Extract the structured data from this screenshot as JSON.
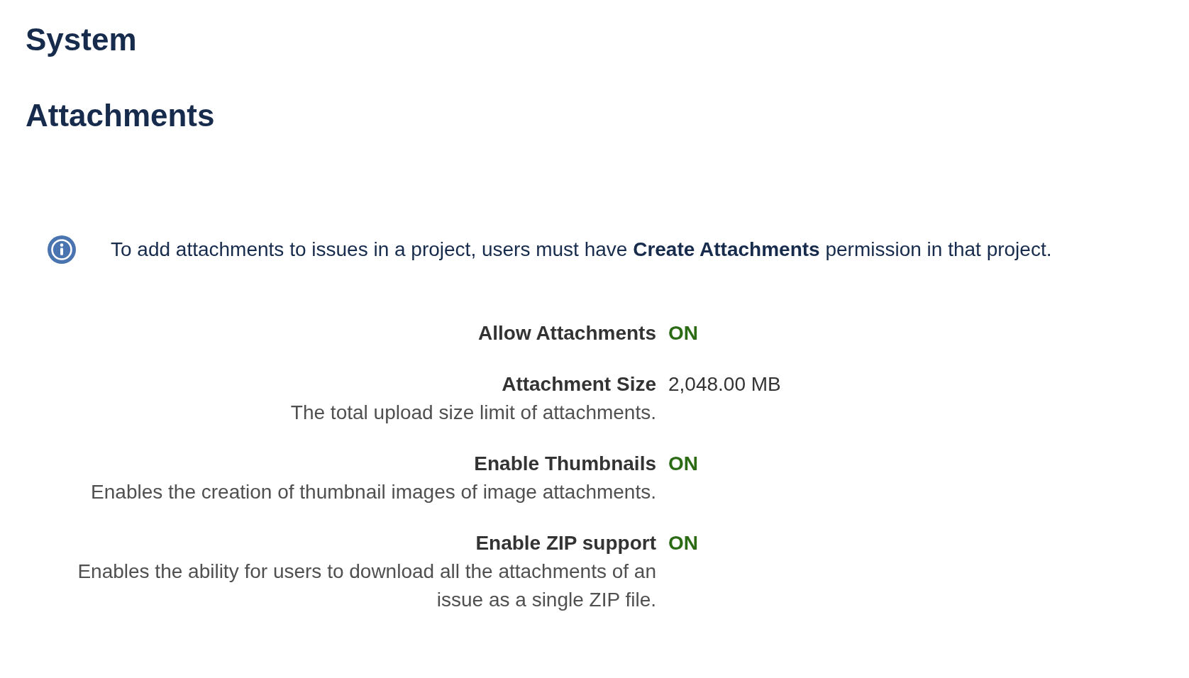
{
  "page_title": "System",
  "section_title": "Attachments",
  "notice": {
    "text": "To add attachments to issues in a project, users must have **Create Attachments** permission in that project."
  },
  "settings": [
    {
      "kind": "flag",
      "label": "Allow Attachments",
      "value": "ON",
      "on": true
    },
    {
      "kind": "text",
      "label": "Attachment Size",
      "value": "2,048.00 MB",
      "description": "The total upload size limit of attachments."
    },
    {
      "kind": "flag",
      "label": "Enable Thumbnails",
      "value": "ON",
      "on": true,
      "description": "Enables the creation of thumbnail images of image attachments."
    },
    {
      "kind": "flag",
      "label": "Enable ZIP support",
      "value": "ON",
      "on": true,
      "description": "Enables the ability for users to download all the attachments of an issue as a single ZIP file."
    }
  ]
}
